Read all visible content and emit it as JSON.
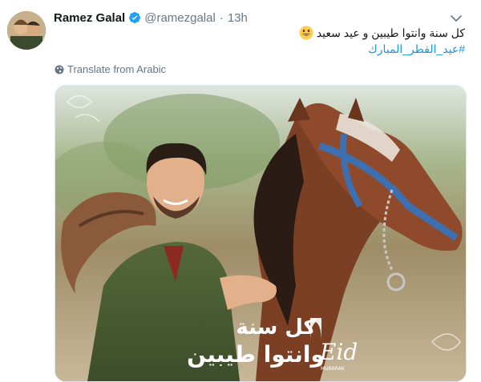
{
  "tweet": {
    "author_name": "Ramez Galal",
    "handle": "@ramezgalal",
    "separator": "·",
    "time": "13h",
    "verified": true,
    "text_line_1": "كل سنة وانتوا طيبين و عيد سعيد",
    "hashtag": "#عيد_الفطر_المبارك",
    "emoji_icon": "grinning-face-emoji",
    "translate_label": "Translate from Arabic",
    "translate_icon": "globe-icon"
  },
  "media": {
    "overlay_text_line_1": "كل سنة",
    "overlay_text_line_2": "وانتوا طيبين",
    "badge_title": "Eid",
    "badge_subtitle": "MUBARAK"
  },
  "colors": {
    "link": "#1b95e0",
    "secondary_text": "#657786",
    "verified_badge": "#1da1f2"
  }
}
